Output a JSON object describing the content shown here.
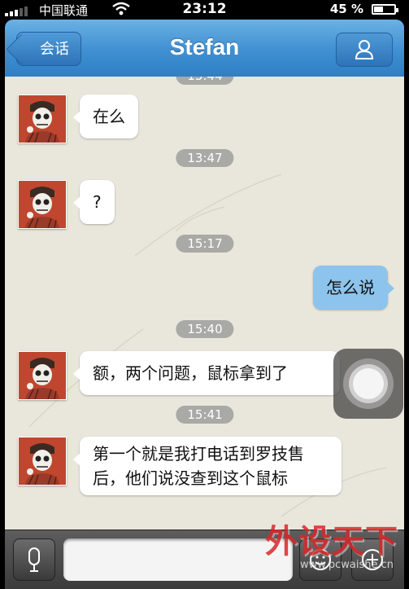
{
  "status_bar": {
    "carrier": "中国联通",
    "time": "23:12",
    "battery_percent": "45 %",
    "battery_level": 0.45
  },
  "nav": {
    "back_label": "会话",
    "title": "Stefan",
    "profile_icon": "person-icon"
  },
  "timestamps": {
    "t0": "13:44",
    "t1": "13:47",
    "t2": "15:17",
    "t3": "15:40",
    "t4": "15:41"
  },
  "messages": [
    {
      "from": "them",
      "text": "在么"
    },
    {
      "from": "them",
      "text": "?"
    },
    {
      "from": "me",
      "text": "怎么说"
    },
    {
      "from": "them",
      "text": "额，两个问题，鼠标拿到了"
    },
    {
      "from": "them",
      "text": "第一个就是我打电话到罗技售后，他们说没查到这个鼠标"
    }
  ],
  "input_bar": {
    "voice_icon": "microphone-icon",
    "emoji_icon": "smiley-icon",
    "plus_icon": "plus-icon"
  },
  "watermark": {
    "brand": "外设天下",
    "url": "www.pcwaishe.cn"
  },
  "colors": {
    "nav_blue": "#3f8fd2",
    "my_bubble": "#8cc4ed",
    "their_bubble": "#ffffff",
    "avatar_red": "#c0462f"
  }
}
